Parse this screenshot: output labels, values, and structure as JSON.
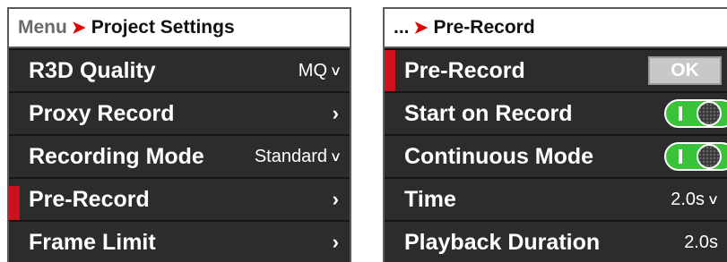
{
  "left_panel": {
    "breadcrumb_parent": "Menu",
    "separator": "➤",
    "title": "Project Settings",
    "rows": [
      {
        "label": "R3D Quality",
        "value": "MQ",
        "control": "dropdown"
      },
      {
        "label": "Proxy Record",
        "control": "submenu"
      },
      {
        "label": "Recording Mode",
        "value": "Standard",
        "control": "dropdown"
      },
      {
        "label": "Pre-Record",
        "control": "submenu",
        "selected": true
      },
      {
        "label": "Frame Limit",
        "control": "submenu"
      }
    ]
  },
  "right_panel": {
    "breadcrumb_parent": "...",
    "separator": "➤",
    "title": "Pre-Record",
    "rows": [
      {
        "label": "Pre-Record",
        "button_label": "OK",
        "control": "button",
        "selected": true
      },
      {
        "label": "Start on Record",
        "control": "toggle",
        "on": true
      },
      {
        "label": "Continuous Mode",
        "control": "toggle",
        "on": true
      },
      {
        "label": "Time",
        "value": "2.0s",
        "control": "dropdown"
      },
      {
        "label": "Playback Duration",
        "value": "2.0s",
        "control": "readonly"
      }
    ]
  },
  "colors": {
    "accent_red": "#d0101a",
    "toggle_on": "#39c339",
    "row_bg": "#2c2c2c"
  },
  "icons": {
    "separator": "chevron-right-red-icon",
    "dropdown": "caret-down-icon",
    "submenu": "chevron-right-icon"
  }
}
